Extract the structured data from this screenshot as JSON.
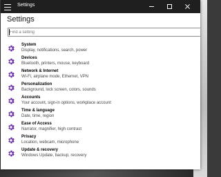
{
  "window": {
    "title": "Settings"
  },
  "page": {
    "title": "Settings"
  },
  "search": {
    "placeholder": "Find a setting"
  },
  "accent_color": "#6b2fa8",
  "categories": [
    {
      "title": "System",
      "subtitle": "Display, notifications, search, power",
      "icon": "gear-icon"
    },
    {
      "title": "Devices",
      "subtitle": "Bluetooth, printers, mouse, keyboard",
      "icon": "gear-icon"
    },
    {
      "title": "Network & Internet",
      "subtitle": "Wi-Fi, airplane mode, Ethernet, VPN",
      "icon": "gear-icon"
    },
    {
      "title": "Personalization",
      "subtitle": "Background, lock screen, colors, sounds",
      "icon": "gear-icon"
    },
    {
      "title": "Accounts",
      "subtitle": "Your account, sign-in options, workplace account",
      "icon": "gear-icon"
    },
    {
      "title": "Time & language",
      "subtitle": "Date, time, region",
      "icon": "gear-icon"
    },
    {
      "title": "Ease of Access",
      "subtitle": "Narrator, magnifier, high contrast",
      "icon": "gear-icon"
    },
    {
      "title": "Privacy",
      "subtitle": "Location, webcam, microphone",
      "icon": "gear-icon"
    },
    {
      "title": "Update & recovery",
      "subtitle": "Windows Update, backup, recovery",
      "icon": "gear-icon"
    }
  ]
}
